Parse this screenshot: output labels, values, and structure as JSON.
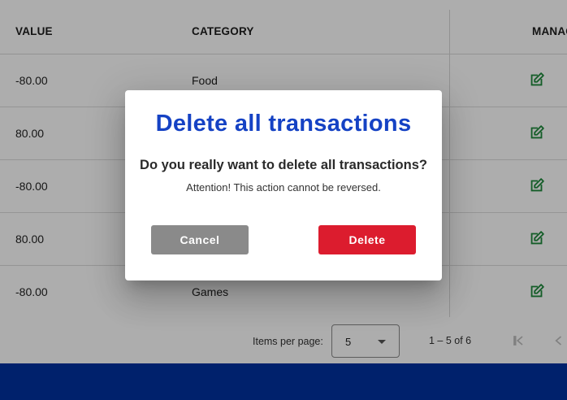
{
  "table": {
    "headers": {
      "value": "VALUE",
      "category": "CATEGORY",
      "manage": "MANAGE"
    },
    "rows": [
      {
        "value": "-80.00",
        "category": "Food"
      },
      {
        "value": "80.00",
        "category": ""
      },
      {
        "value": "-80.00",
        "category": ""
      },
      {
        "value": "80.00",
        "category": ""
      },
      {
        "value": "-80.00",
        "category": "Games"
      }
    ],
    "edit_icon_color": "#1e8a3c"
  },
  "paginator": {
    "items_per_page_label": "Items per page:",
    "items_per_page_value": "5",
    "range_label": "1 – 5 of 6"
  },
  "dialog": {
    "title": "Delete all transactions",
    "question": "Do you really want to delete all transactions?",
    "warning": "Attention! This action cannot be reversed.",
    "cancel_label": "Cancel",
    "delete_label": "Delete"
  },
  "colors": {
    "title_blue": "#1542c4",
    "delete_red": "#dc1c2e",
    "cancel_gray": "#8a8a8a",
    "footer_blue": "#0032a0"
  }
}
